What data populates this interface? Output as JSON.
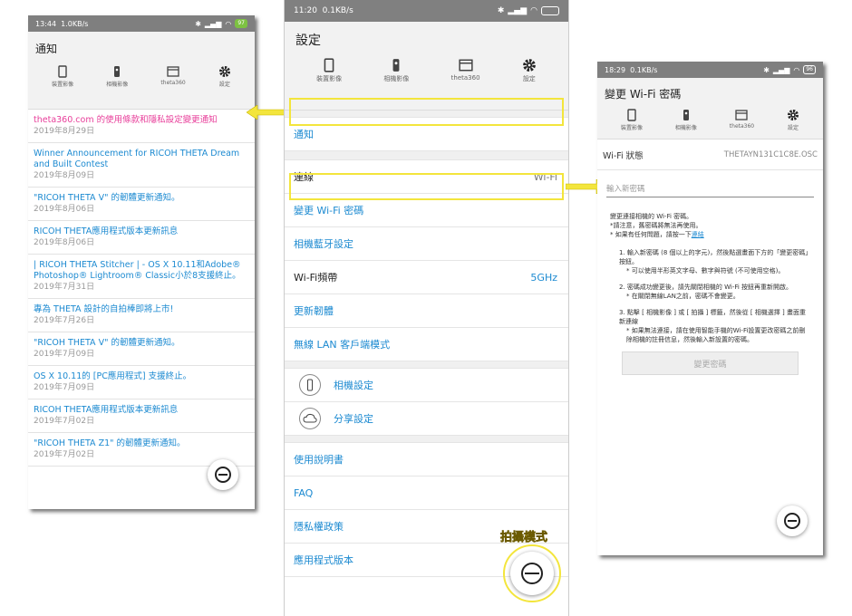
{
  "left": {
    "status": {
      "time": "13:44",
      "speed": "1.0KB/s",
      "battery": "97"
    },
    "title": "通知",
    "tabs": [
      {
        "label": "裝置影像",
        "icon": "phone-icon"
      },
      {
        "label": "相機影像",
        "icon": "camera-icon"
      },
      {
        "label": "theta360",
        "icon": "browser-icon"
      },
      {
        "label": "設定",
        "icon": "gear-icon"
      }
    ],
    "notifications": [
      {
        "title": "theta360.com 的使用條款和隱私設定變更通知",
        "date": "2019年8月29日"
      },
      {
        "title": "Winner Announcement for RICOH THETA Dream and Built Contest",
        "date": "2019年8月09日"
      },
      {
        "title": "\"RICOH THETA V\" 的韌體更新通知。",
        "date": "2019年8月06日"
      },
      {
        "title": "RICOH THETA應用程式版本更新訊息",
        "date": "2019年8月06日"
      },
      {
        "title": "| RICOH THETA Stitcher | - OS X 10.11和Adobe® Photoshop® Lightroom® Classic小於8支援終止。",
        "date": "2019年7月31日"
      },
      {
        "title": "專為 THETA 設計的自拍棒即將上市!",
        "date": "2019年7月26日"
      },
      {
        "title": "\"RICOH THETA V\" 的韌體更新通知。",
        "date": "2019年7月09日"
      },
      {
        "title": "OS X 10.11的 [PC應用程式] 支援終止。",
        "date": "2019年7月09日"
      },
      {
        "title": "RICOH THETA應用程式版本更新訊息",
        "date": "2019年7月02日"
      },
      {
        "title": "\"RICOH THETA Z1\" 的韌體更新通知。",
        "date": "2019年7月02日"
      }
    ]
  },
  "mid": {
    "status": {
      "time": "11:20",
      "speed": "0.1KB/s"
    },
    "title": "設定",
    "tabs": [
      {
        "label": "裝置影像",
        "icon": "phone-icon"
      },
      {
        "label": "相機影像",
        "icon": "camera-icon"
      },
      {
        "label": "theta360",
        "icon": "browser-icon"
      },
      {
        "label": "設定",
        "icon": "gear-icon"
      }
    ],
    "rows": {
      "notify": "通知",
      "connection": "連線",
      "connection_val": "Wi-Fi",
      "change_wifi": "變更 Wi-Fi 密碼",
      "bluetooth": "相機藍牙設定",
      "wifi_band": "Wi-Fi頻帶",
      "wifi_band_val": "5GHz",
      "firmware": "更新韌體",
      "wlan_client": "無線 LAN 客戶端模式",
      "camera_settings": "相機設定",
      "share_settings": "分享設定",
      "manual": "使用說明書",
      "faq": "FAQ",
      "privacy": "隱私權政策",
      "app_version": "應用程式版本"
    },
    "callout": "拍攝模式"
  },
  "right": {
    "status": {
      "time": "18:29",
      "speed": "0.1KB/s",
      "battery": "96"
    },
    "title": "變更 Wi-Fi 密碼",
    "tabs": [
      {
        "label": "裝置影像",
        "icon": "phone-icon"
      },
      {
        "label": "相機影像",
        "icon": "camera-icon"
      },
      {
        "label": "theta360",
        "icon": "browser-icon"
      },
      {
        "label": "設定",
        "icon": "gear-icon"
      }
    ],
    "wifi_status_label": "Wi-Fi 狀態",
    "wifi_status_value": "THETAYN131C1C8E.OSC",
    "password_placeholder": "輸入新密碼",
    "intro1": "變更連接相機的 Wi-Fi 密碼。",
    "intro2": "*請注意，舊密碼將無法再使用。",
    "intro3": "* 如果有任何問題，請按一下",
    "intro_link": "連結",
    "step1": "1. 輸入新密碼 (8 個以上的字元)，然後點選畫面下方的「變更密碼」按鈕。",
    "step1_note": "* 可以使用半形英文字母、數字與符號 (不可使用空格)。",
    "step2": "2. 密碼成功變更後，請先關閉相機的 Wi-Fi 按鈕再重新開啟。",
    "step2_note": "* 在關閉無線LAN之前，密碼不會變更。",
    "step3": "3. 點擊 [ 相機影像 ] 或 [ 拍攝 ] 標籤，然後從 [ 相機選擇 ] 畫面重新連線",
    "step3_note": "* 如果無法連接，請在使用智能手機的Wi-Fi設置更改密碼之前刪除相機的註冊信息，然後輸入新設置的密碼。",
    "button": "變更密碼"
  },
  "colors": {
    "highlight": "#f3e53c",
    "link": "#1c8ad1",
    "pink": "#e83e9a"
  }
}
